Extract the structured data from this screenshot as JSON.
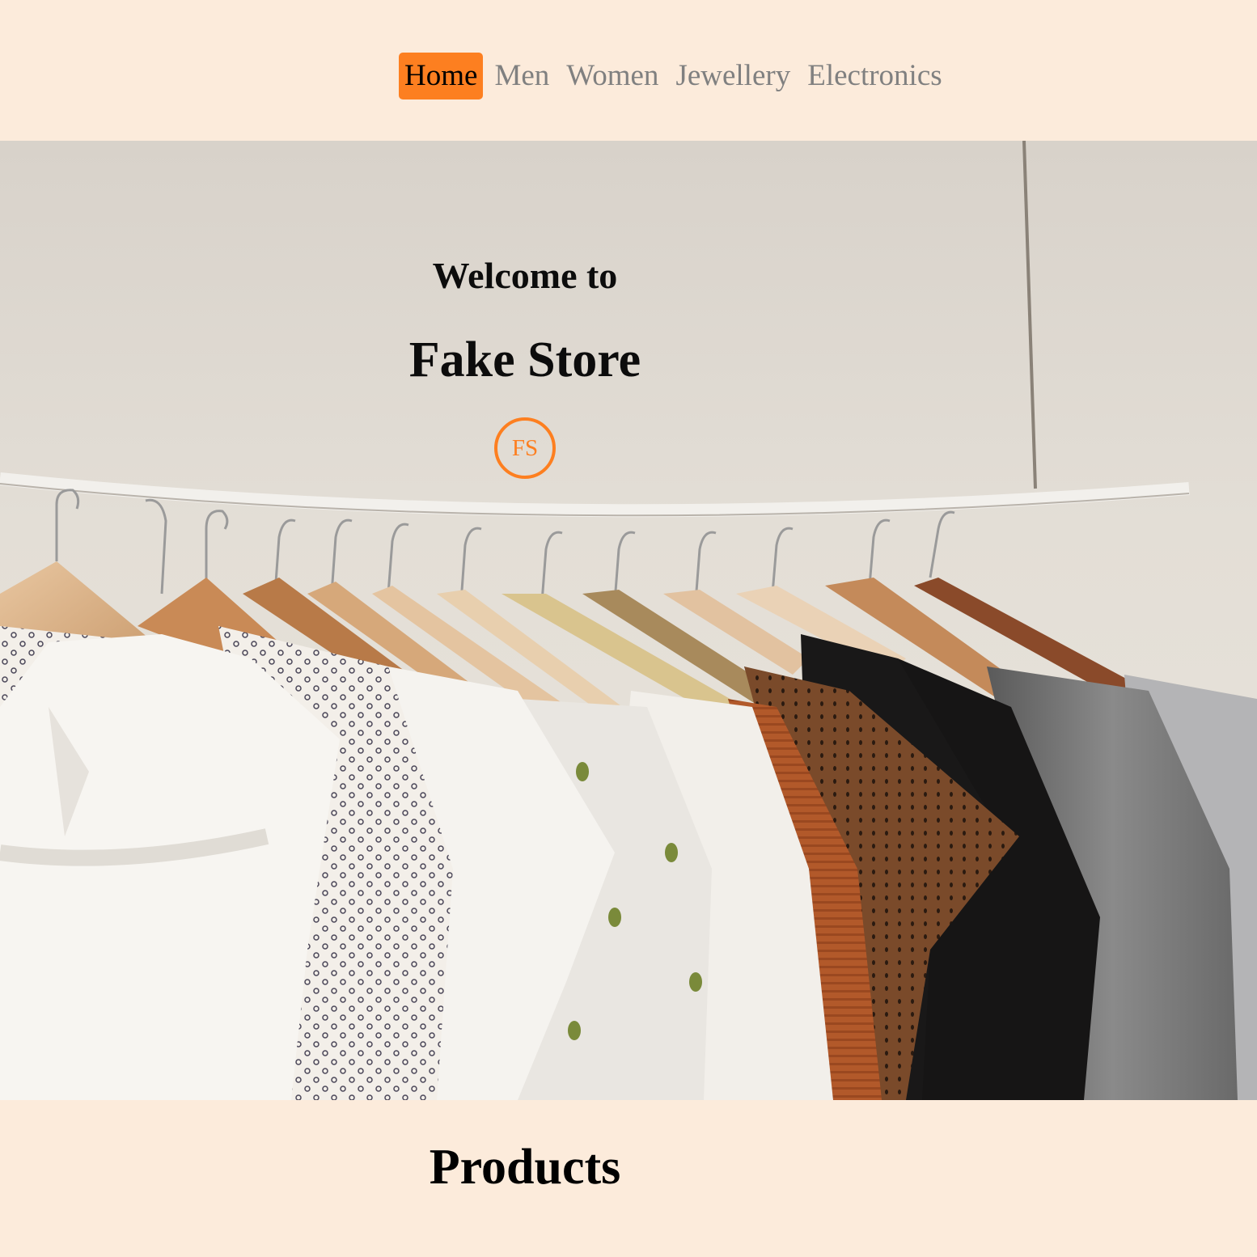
{
  "nav": {
    "items": [
      {
        "label": "Home",
        "active": true
      },
      {
        "label": "Men",
        "active": false
      },
      {
        "label": "Women",
        "active": false
      },
      {
        "label": "Jewellery",
        "active": false
      },
      {
        "label": "Electronics",
        "active": false
      }
    ]
  },
  "hero": {
    "welcome": "Welcome to",
    "title": "Fake Store",
    "badge": "FS",
    "image": "clothing-rack-photo"
  },
  "products": {
    "heading": "Products"
  },
  "colors": {
    "background": "#fcebdb",
    "accent": "#fd7f20",
    "nav_text": "#808080"
  }
}
